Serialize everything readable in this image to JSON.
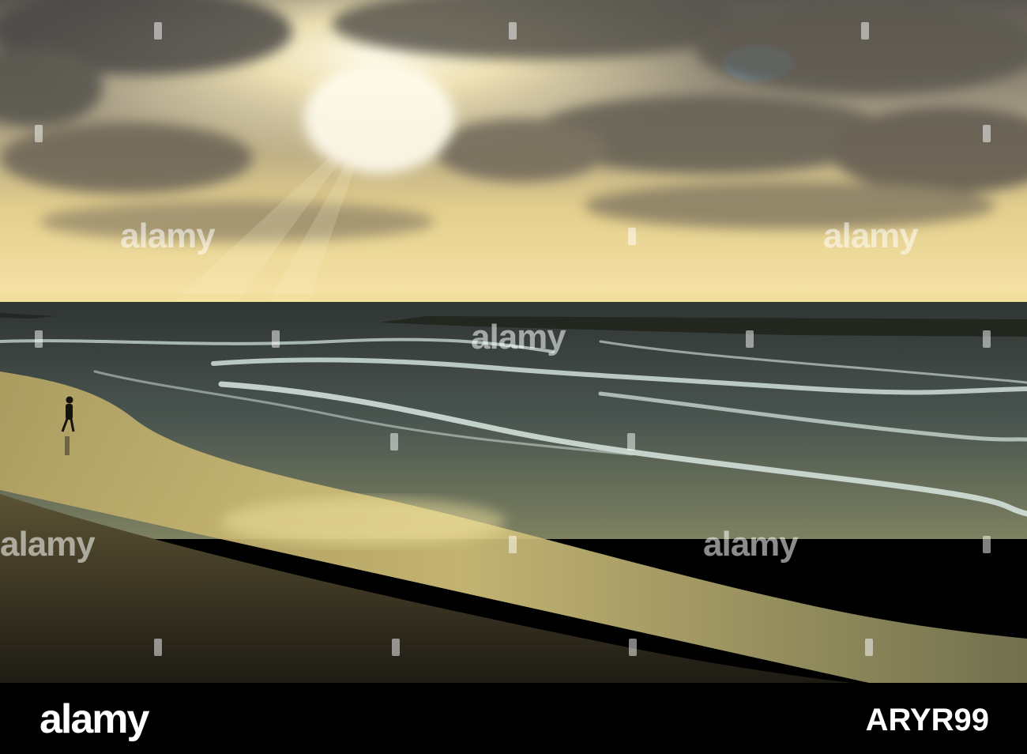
{
  "watermark": {
    "text": "alamy"
  },
  "footer": {
    "brand": "alamy",
    "image_id": "ARYR99"
  },
  "colors": {
    "sky_bright": "#fff4c8",
    "sky_gold": "#e9cf86",
    "cloud_dark": "#4c4a47",
    "sea": "#3e4a47",
    "foam": "#d6e6e0",
    "sand": "#2d2a20",
    "footer_bg": "#000000"
  }
}
